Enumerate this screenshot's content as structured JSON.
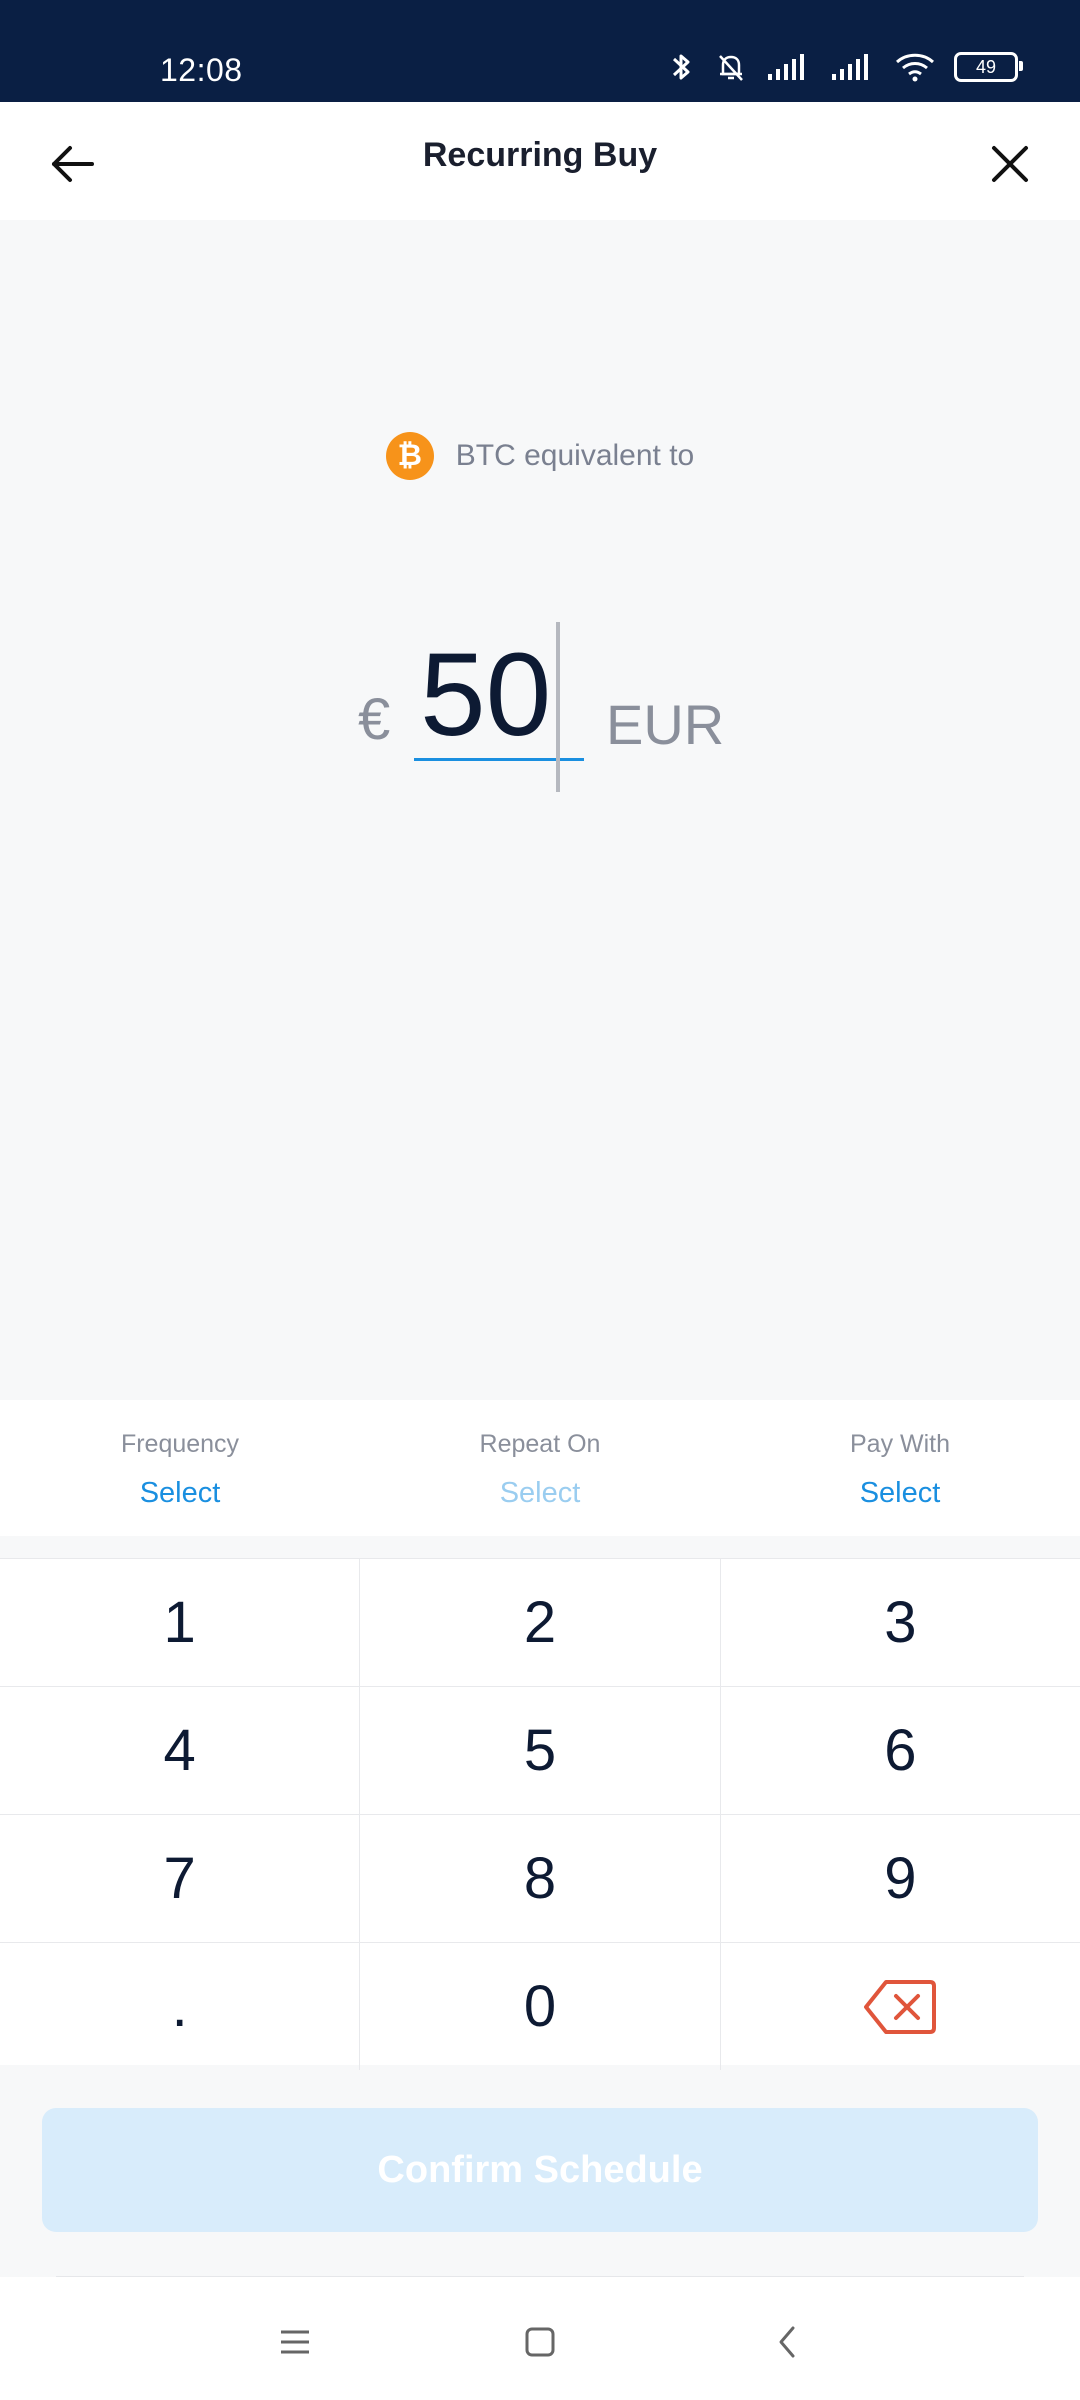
{
  "status_bar": {
    "time": "12:08",
    "battery": "49"
  },
  "header": {
    "title": "Recurring Buy"
  },
  "asset": {
    "icon_glyph": "₿",
    "label": "BTC equivalent to"
  },
  "amount": {
    "currency_symbol": "€",
    "value": "50",
    "currency_code": "EUR"
  },
  "options": [
    {
      "label": "Frequency",
      "value": "Select"
    },
    {
      "label": "Repeat On",
      "value": "Select"
    },
    {
      "label": "Pay With",
      "value": "Select"
    }
  ],
  "keypad": {
    "rows": [
      [
        "1",
        "2",
        "3"
      ],
      [
        "4",
        "5",
        "6"
      ],
      [
        "7",
        "8",
        "9"
      ],
      [
        ".",
        "0",
        ""
      ]
    ]
  },
  "confirm": {
    "label": "Confirm Schedule"
  },
  "colors": {
    "status_bar_bg": "#0a1f44",
    "accent": "#1a8fe0",
    "btc_orange": "#f7931a",
    "backspace_red": "#e0553b",
    "confirm_disabled_bg": "#d8ecfb"
  },
  "icons": {
    "back": "arrow-left-icon",
    "close": "close-icon",
    "backspace": "backspace-icon",
    "nav_menu": "menu-icon",
    "nav_home": "home-icon",
    "nav_back": "chevron-left-icon"
  }
}
